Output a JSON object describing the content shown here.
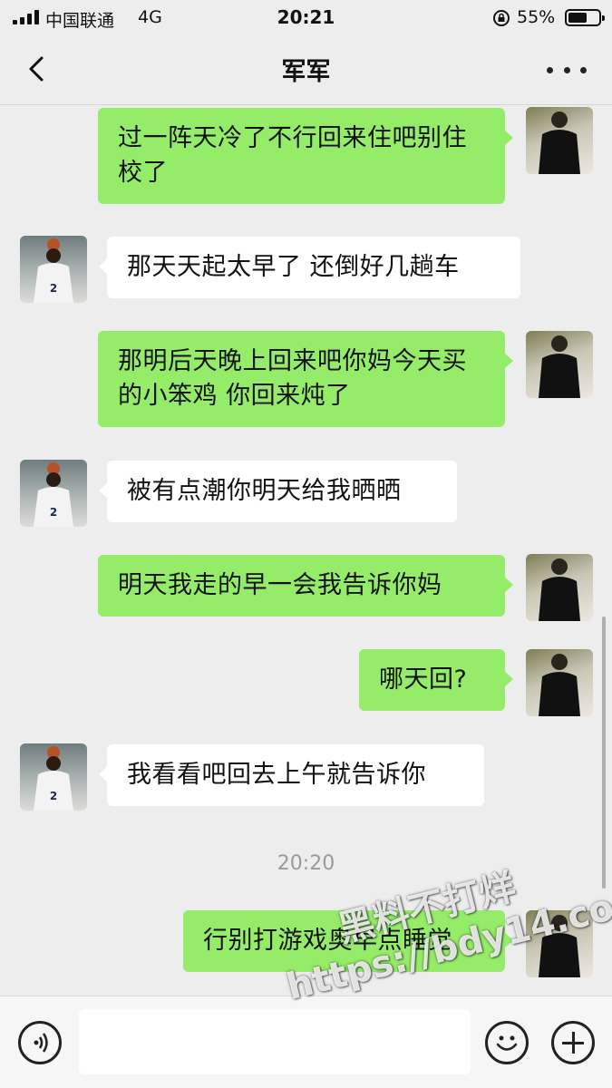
{
  "status_bar": {
    "carrier": "中国联通",
    "network": "4G",
    "time": "20:21",
    "battery_percent": "55%",
    "battery_level": 0.55
  },
  "nav": {
    "title": "军军"
  },
  "messages": [
    {
      "sender": "self",
      "text": "过一阵天冷了不行回来住吧别住校了"
    },
    {
      "sender": "other",
      "text": "那天天起太早了 还倒好几趟车"
    },
    {
      "sender": "self",
      "text": "那明后天晚上回来吧你妈今天买的小笨鸡 你回来炖了"
    },
    {
      "sender": "other",
      "text": "被有点潮你明天给我晒晒"
    },
    {
      "sender": "self",
      "text": "明天我走的早一会我告诉你妈"
    },
    {
      "sender": "self",
      "text": "哪天回?"
    },
    {
      "sender": "other",
      "text": "我看看吧回去上午就告诉你"
    },
    {
      "sender": "self",
      "text": "行别打游戏奥早点睡觉"
    }
  ],
  "timestamp": "20:20",
  "input_bar": {
    "placeholder": ""
  },
  "watermark": {
    "line1": "黑料不打烊",
    "line2": "https://bdy14.co"
  },
  "colors": {
    "self_bubble": "#95ec69",
    "other_bubble": "#ffffff",
    "background": "#ededed"
  }
}
